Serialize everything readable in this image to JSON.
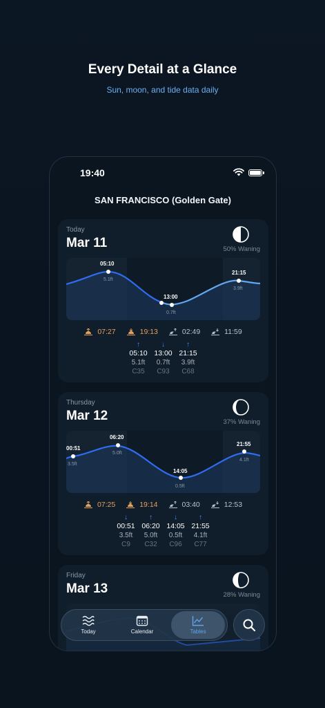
{
  "hero": {
    "title": "Every Detail at a Glance",
    "subtitle": "Sun, moon, and tide data daily"
  },
  "status_bar": {
    "time": "19:40"
  },
  "location": "SAN FRANCISCO (Golden Gate)",
  "colors": {
    "accent": "#5ea6ec",
    "sun": "#e4a25d",
    "tide_arrow": "#4c8ff5",
    "card_bg": "#101d2a"
  },
  "days": [
    {
      "day": "Today",
      "date": "Mar 11",
      "moon_phase": "50% Waning",
      "sunrise": "07:27",
      "sunset": "19:13",
      "moonrise": "02:49",
      "moonset": "11:59",
      "tides": [
        {
          "dir": "↑",
          "time": "05:10",
          "height": "5.1ft",
          "coef": "C35"
        },
        {
          "dir": "↓",
          "time": "13:00",
          "height": "0.7ft",
          "coef": "C93"
        },
        {
          "dir": "↑",
          "time": "21:15",
          "height": "3.9ft",
          "coef": "C68"
        }
      ]
    },
    {
      "day": "Thursday",
      "date": "Mar 12",
      "moon_phase": "37% Waning",
      "sunrise": "07:25",
      "sunset": "19:14",
      "moonrise": "03:40",
      "moonset": "12:53",
      "tides": [
        {
          "dir": "↓",
          "time": "00:51",
          "height": "3.5ft",
          "coef": "C9"
        },
        {
          "dir": "↑",
          "time": "06:20",
          "height": "5.0ft",
          "coef": "C32"
        },
        {
          "dir": "↓",
          "time": "14:05",
          "height": "0.5ft",
          "coef": "C96"
        },
        {
          "dir": "↑",
          "time": "21:55",
          "height": "4.1ft",
          "coef": "C77"
        }
      ]
    },
    {
      "day": "Friday",
      "date": "Mar 13",
      "moon_phase": "28% Waning"
    }
  ],
  "nav": {
    "today": "Today",
    "calendar": "Calendar",
    "tables": "Tables"
  }
}
